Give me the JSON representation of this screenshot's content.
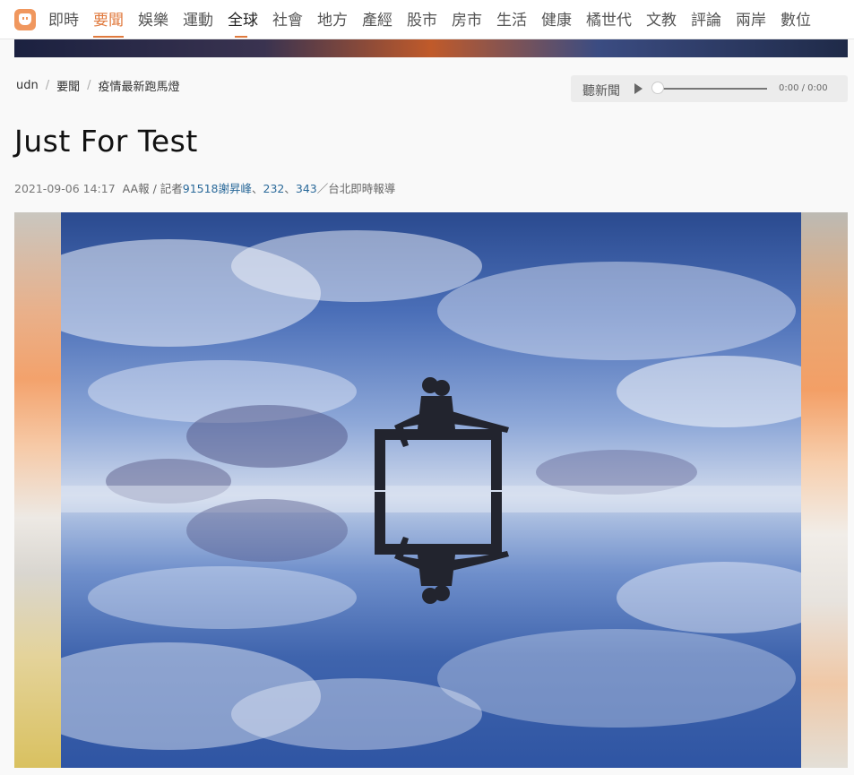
{
  "nav": {
    "items": [
      {
        "label": "即時",
        "state": "normal"
      },
      {
        "label": "要聞",
        "state": "active"
      },
      {
        "label": "娛樂",
        "state": "normal"
      },
      {
        "label": "運動",
        "state": "normal"
      },
      {
        "label": "全球",
        "state": "current"
      },
      {
        "label": "社會",
        "state": "normal"
      },
      {
        "label": "地方",
        "state": "normal"
      },
      {
        "label": "產經",
        "state": "normal"
      },
      {
        "label": "股市",
        "state": "normal"
      },
      {
        "label": "房市",
        "state": "normal"
      },
      {
        "label": "生活",
        "state": "normal"
      },
      {
        "label": "健康",
        "state": "normal"
      },
      {
        "label": "橘世代",
        "state": "normal"
      },
      {
        "label": "文教",
        "state": "normal"
      },
      {
        "label": "評論",
        "state": "normal"
      },
      {
        "label": "兩岸",
        "state": "normal"
      },
      {
        "label": "數位",
        "state": "normal"
      }
    ],
    "accent_color": "#e07a3e"
  },
  "breadcrumb": [
    "udn",
    "要聞",
    "疫情最新跑馬燈"
  ],
  "player": {
    "label": "聽新聞",
    "time": "0:00 / 0:00",
    "progress": 0
  },
  "article": {
    "title": "Just For Test",
    "date": "2021-09-06 14:17",
    "meta_prefix": "AA報 / 記者",
    "reporter1": "91518謝昇峰",
    "sep1": "、",
    "reporter2": "232",
    "sep2": "、",
    "reporter3": "343",
    "meta_suffix": "／台北即時報導"
  },
  "hero_image": {
    "subject": "two-figures-on-frame-reflected-in-salt-flat-sky"
  }
}
